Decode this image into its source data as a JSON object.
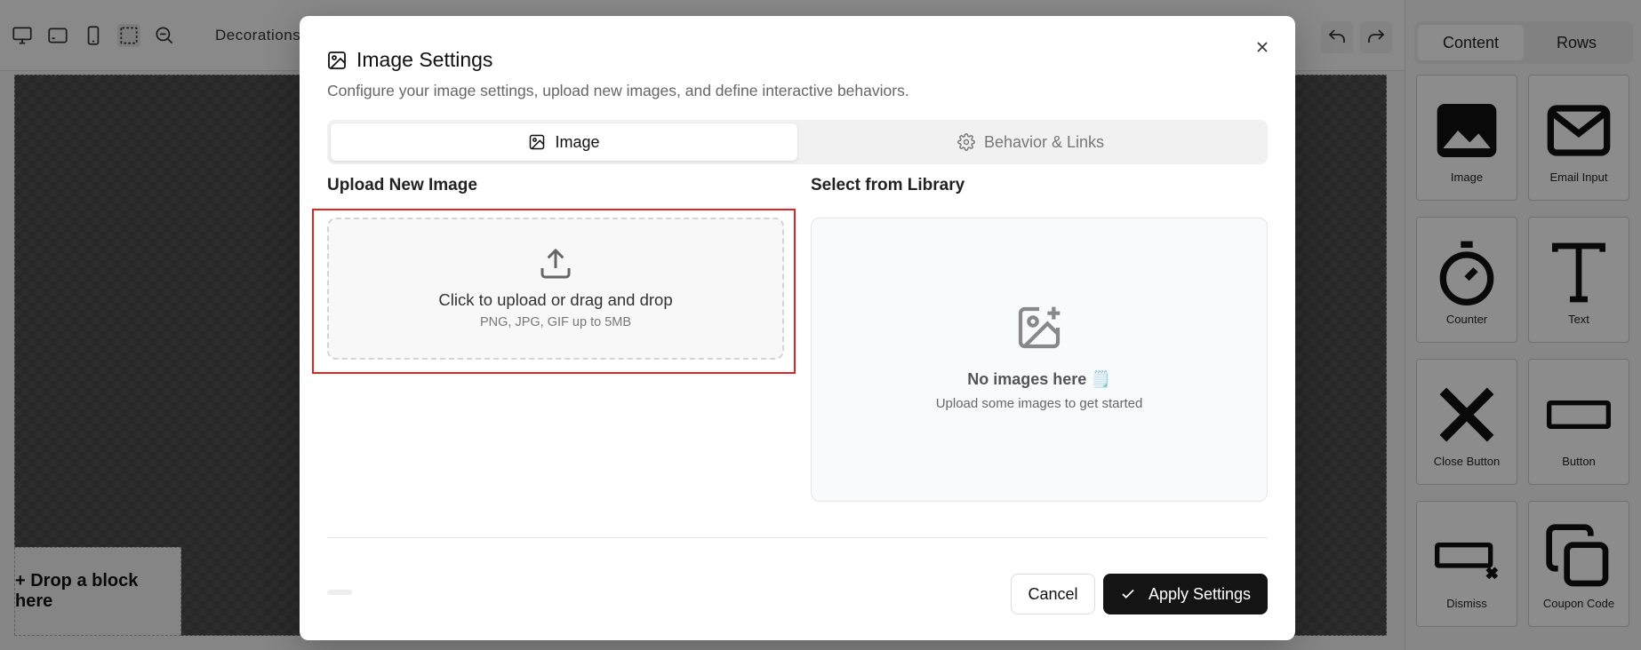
{
  "toolbar": {
    "decorations_label": "Decorations",
    "icons": [
      "desktop-icon",
      "tablet-landscape-icon",
      "mobile-icon",
      "select-area-icon",
      "zoom-out-icon"
    ],
    "undo_icon": "undo-icon",
    "redo_icon": "redo-icon"
  },
  "canvas": {
    "drop_block_label": "+ Drop a block here"
  },
  "right_panel": {
    "tabs": [
      "Content",
      "Rows"
    ],
    "blocks": [
      {
        "label": "Image",
        "icon": "image-icon"
      },
      {
        "label": "Email Input",
        "icon": "envelope-icon"
      },
      {
        "label": "Counter",
        "icon": "stopwatch-icon"
      },
      {
        "label": "Text",
        "icon": "text-icon"
      },
      {
        "label": "Close Button",
        "icon": "close-x-icon"
      },
      {
        "label": "Button",
        "icon": "button-rect-icon"
      },
      {
        "label": "Dismiss",
        "icon": "dismiss-icon"
      },
      {
        "label": "Coupon Code",
        "icon": "copy-icon"
      }
    ]
  },
  "modal": {
    "title": "Image Settings",
    "description": "Configure your image settings, upload new images, and define interactive behaviors.",
    "tabs": [
      {
        "label": "Image",
        "icon": "image-icon",
        "active": true
      },
      {
        "label": "Behavior & Links",
        "icon": "gear-icon",
        "active": false
      }
    ],
    "upload": {
      "heading": "Upload New Image",
      "main_text": "Click to upload or drag and drop",
      "sub_text": "PNG, JPG, GIF up to 5MB",
      "highlight_color": "#e02424"
    },
    "library": {
      "heading": "Select from Library",
      "empty_title": "No images here 🗒️",
      "empty_sub": "Upload some images to get started"
    },
    "buttons": {
      "cancel": "Cancel",
      "apply": "Apply Settings"
    },
    "colors": {
      "primary_button": "#141414",
      "highlight": "#e02424"
    }
  }
}
